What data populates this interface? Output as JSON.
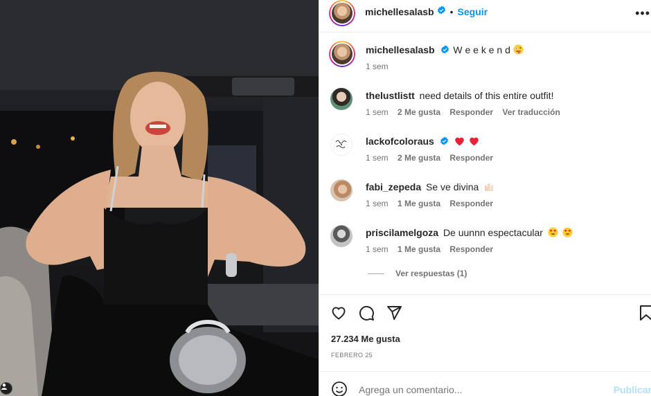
{
  "post": {
    "author": "michellesalasb",
    "verified": true,
    "follow_label": "Seguir",
    "separator": "•",
    "more_label": "•••"
  },
  "caption": {
    "author": "michellesalasb",
    "text": "W e e k e n d",
    "time": "1 sem"
  },
  "comments": [
    {
      "user": "thelustlistt",
      "verified": false,
      "text": "need details of this entire outfit!",
      "time": "1 sem",
      "likes": "2 Me gusta",
      "reply": "Responder",
      "translate": "Ver traducción"
    },
    {
      "user": "lackofcoloraus",
      "verified": true,
      "text": "",
      "time": "1 sem",
      "likes": "2 Me gusta",
      "reply": "Responder"
    },
    {
      "user": "fabi_zepeda",
      "verified": false,
      "text": "Se ve divina",
      "time": "1 sem",
      "likes": "1 Me gusta",
      "reply": "Responder"
    },
    {
      "user": "priscilamelgoza",
      "verified": false,
      "text": "De uunnn espectacular",
      "time": "1 sem",
      "likes": "1 Me gusta",
      "reply": "Responder"
    }
  ],
  "view_replies": "Ver respuestas (1)",
  "likes_count": "27.234 Me gusta",
  "date": "FEBRERO 25",
  "add_comment": {
    "placeholder": "Agrega un comentario...",
    "publish_label": "Publicar"
  },
  "icons": {
    "like": "heart-icon",
    "comment": "comment-icon",
    "share": "share-icon",
    "save": "bookmark-icon",
    "emoji": "emoji-icon",
    "verified": "verified-badge-icon"
  },
  "colors": {
    "accent": "#0095f6",
    "text": "#262626",
    "secondary": "#737373",
    "publish_disabled": "#b2dffc"
  }
}
